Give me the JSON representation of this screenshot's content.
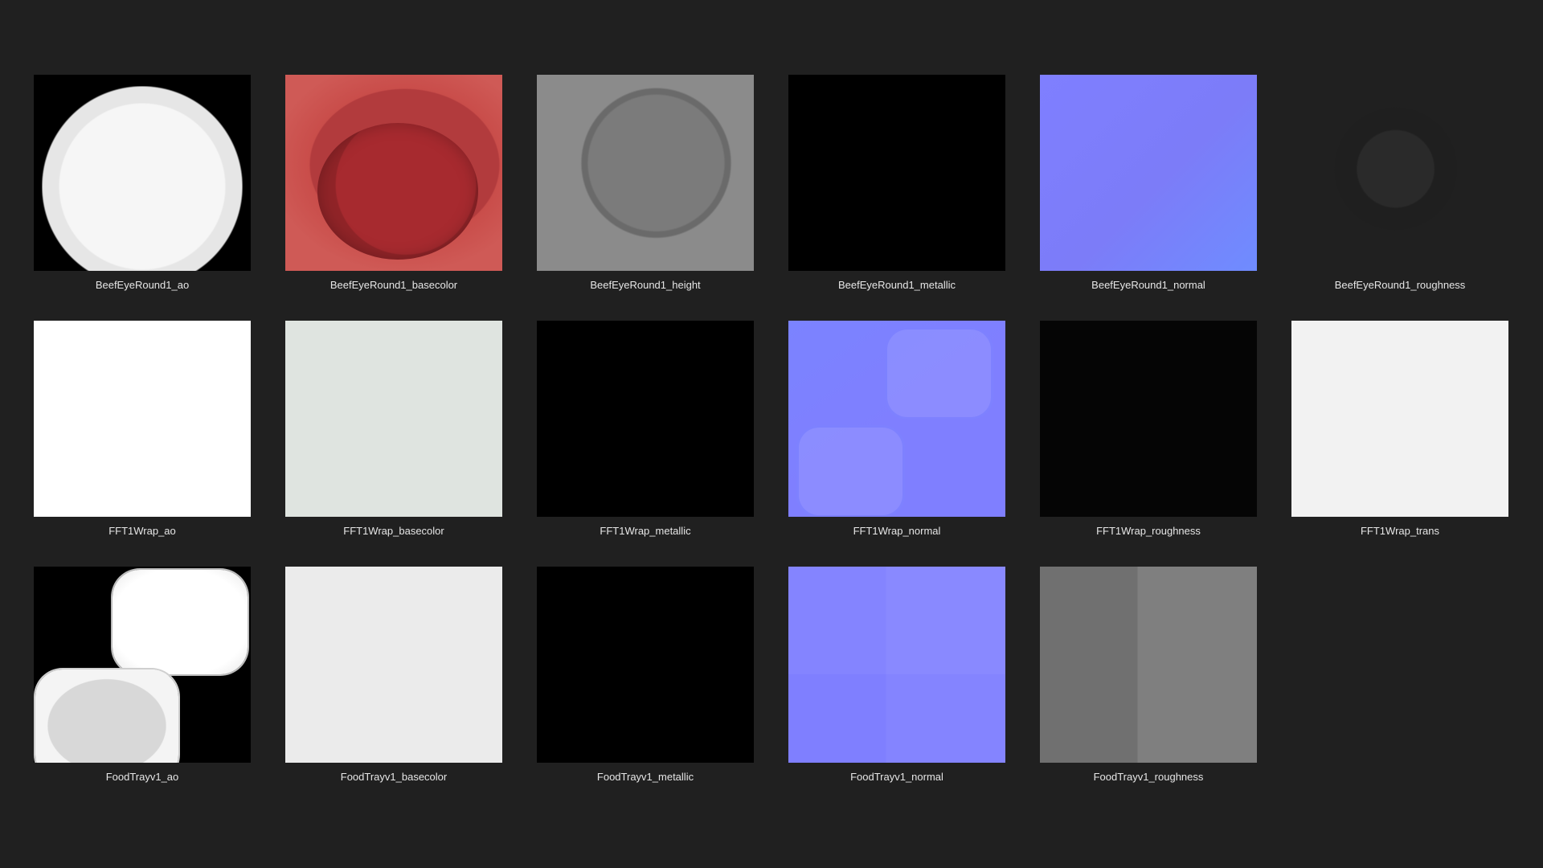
{
  "tiles": [
    {
      "label": "BeefEyeRound1_ao",
      "style": "t-ao-beef"
    },
    {
      "label": "BeefEyeRound1_basecolor",
      "style": "t-basecolor-beef"
    },
    {
      "label": "BeefEyeRound1_height",
      "style": "t-height-beef"
    },
    {
      "label": "BeefEyeRound1_metallic",
      "style": "t-black"
    },
    {
      "label": "BeefEyeRound1_normal",
      "style": "t-normal-beef"
    },
    {
      "label": "BeefEyeRound1_roughness",
      "style": "t-dark"
    },
    {
      "label": "FFT1Wrap_ao",
      "style": "t-white"
    },
    {
      "label": "FFT1Wrap_basecolor",
      "style": "t-paleg"
    },
    {
      "label": "FFT1Wrap_metallic",
      "style": "t-black"
    },
    {
      "label": "FFT1Wrap_normal",
      "style": "t-normal-wrap"
    },
    {
      "label": "FFT1Wrap_roughness",
      "style": "t-nearblack"
    },
    {
      "label": "FFT1Wrap_trans",
      "style": "t-offwhite"
    },
    {
      "label": "FoodTrayv1_ao",
      "style": "t-ao-tray"
    },
    {
      "label": "FoodTrayv1_basecolor",
      "style": "t-lightgrey"
    },
    {
      "label": "FoodTrayv1_metallic",
      "style": "t-black"
    },
    {
      "label": "FoodTrayv1_normal",
      "style": "t-normal-tray"
    },
    {
      "label": "FoodTrayv1_roughness",
      "style": "t-rough-tray"
    }
  ]
}
